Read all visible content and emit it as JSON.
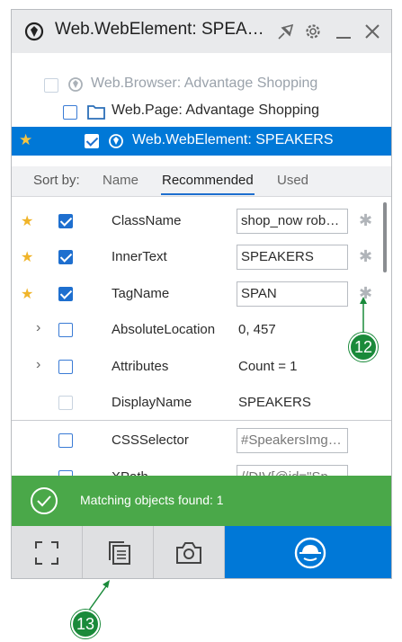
{
  "window": {
    "title": "Web.WebElement: SPEA…"
  },
  "tree": {
    "items": [
      {
        "label": "Web.Browser:  Advantage Shopping",
        "faded": true
      },
      {
        "label": "Web.Page:  Advantage Shopping",
        "faded": false
      },
      {
        "label": "Web.WebElement: SPEAKERS",
        "selected": true
      }
    ],
    "splitter": "...."
  },
  "sort": {
    "label": "Sort by:",
    "tabs": [
      "Name",
      "Recommended",
      "Used"
    ],
    "active_tab": "Recommended"
  },
  "properties": [
    {
      "name": "ClassName",
      "value": "shop_now robo…",
      "starred": true,
      "checked": true,
      "boxed": true
    },
    {
      "name": "InnerText",
      "value": "SPEAKERS",
      "starred": true,
      "checked": true,
      "boxed": true
    },
    {
      "name": "TagName",
      "value": "SPAN",
      "starred": true,
      "checked": true,
      "boxed": true
    },
    {
      "name": "AbsoluteLocation",
      "value": "0, 457",
      "expandable": true
    },
    {
      "name": "Attributes",
      "value": "Count = 1",
      "expandable": true
    },
    {
      "name": "DisplayName",
      "value": "SPEAKERS",
      "faded_checkbox": true
    },
    {
      "name": "CSSSelector",
      "value": "#SpeakersImg…",
      "boxed": true,
      "gray": true
    },
    {
      "name": "XPath",
      "value": "//DIV[@id=\"Sp…",
      "boxed": true,
      "gray": true
    }
  ],
  "status": {
    "message": "Matching objects found: 1",
    "color": "#4aa849"
  },
  "bottom_buttons": [
    "expand-icon",
    "copy-icon",
    "camera-icon",
    "spy-icon"
  ],
  "callouts": [
    "12",
    "13"
  ],
  "colors": {
    "accent": "#0078d7",
    "star": "#f0b429",
    "callout": "#1a8a3a"
  }
}
